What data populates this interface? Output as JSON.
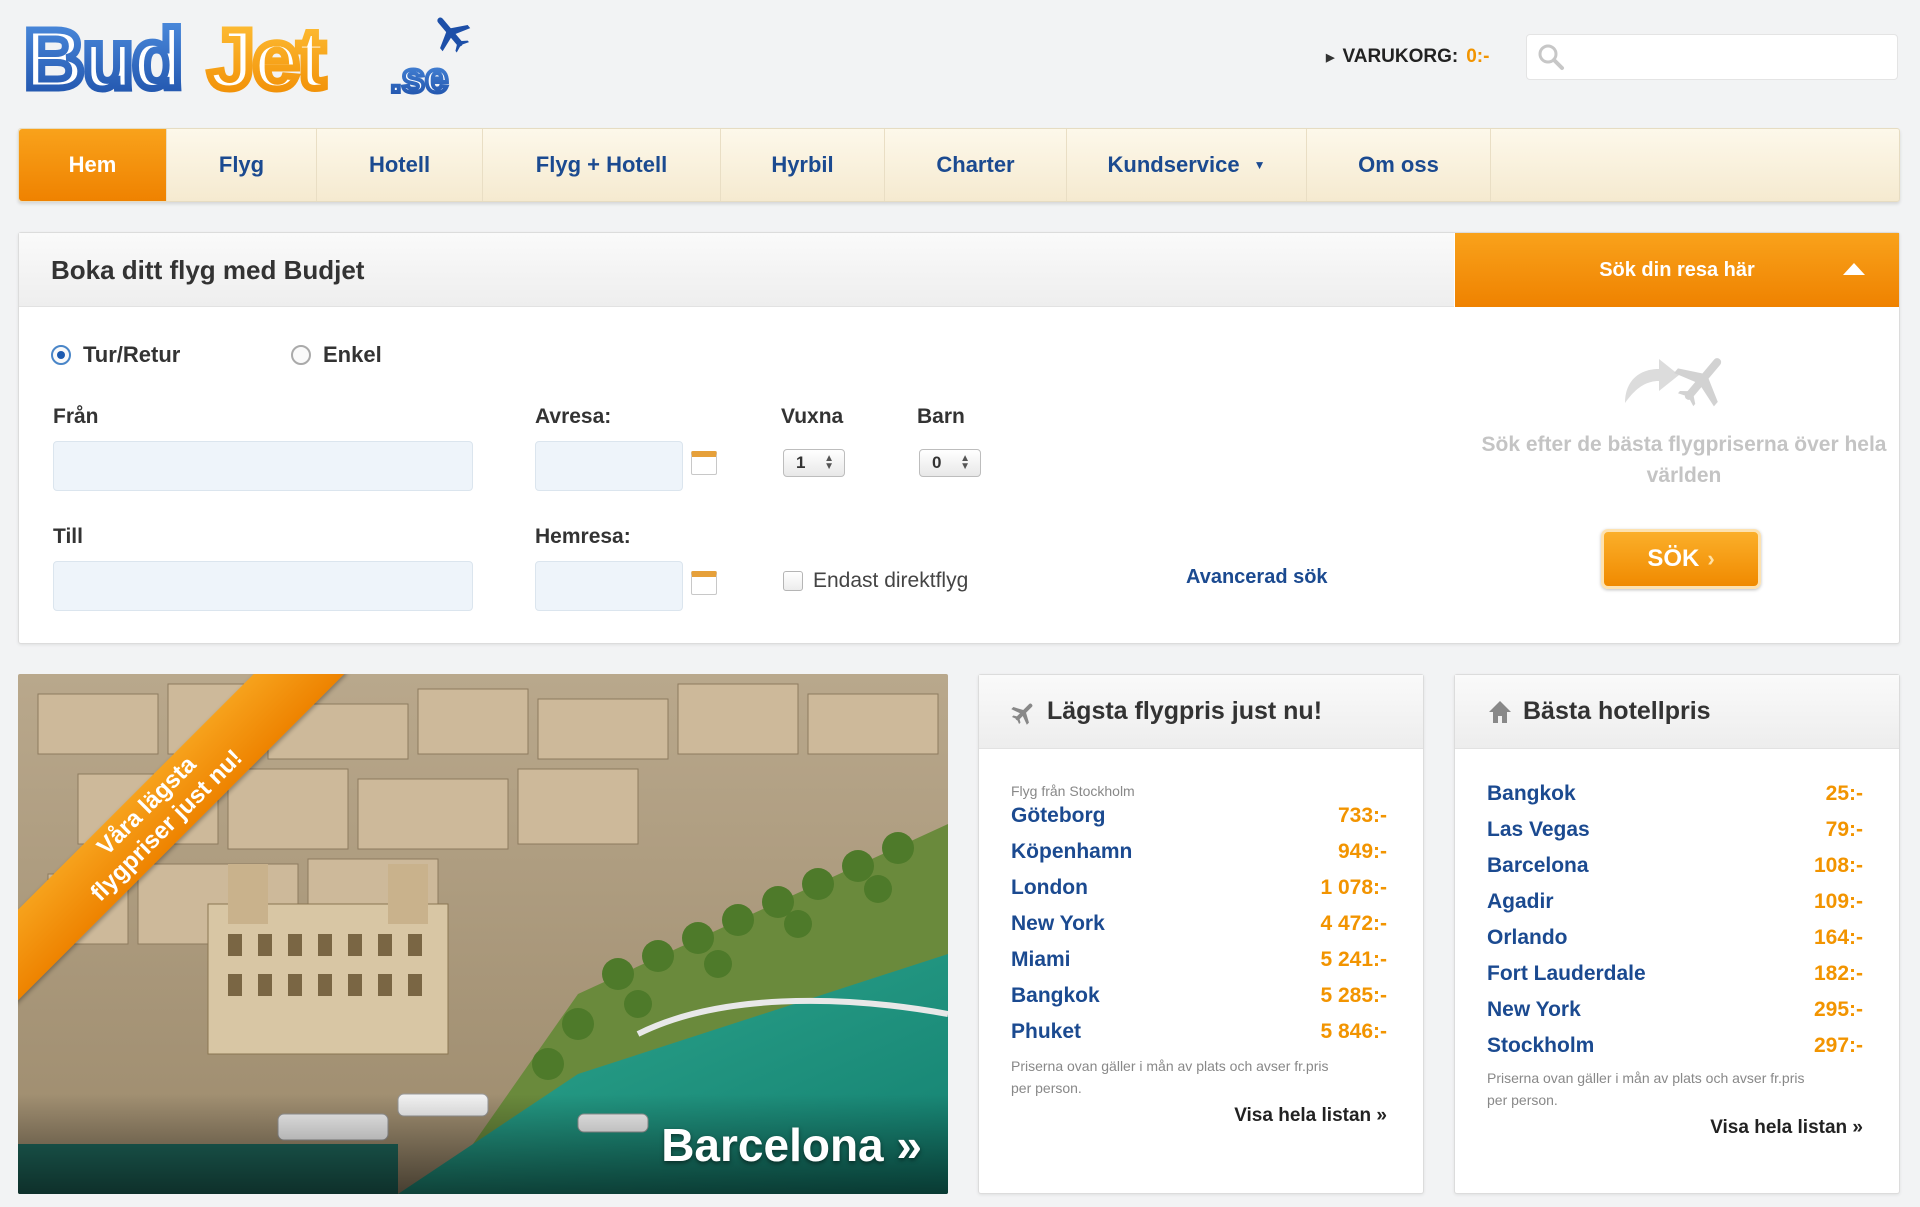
{
  "header": {
    "logo_text": "BudJet.se",
    "cart_label": "VARUKORG:",
    "cart_amount": "0:-",
    "search_placeholder": ""
  },
  "nav": {
    "items": [
      {
        "label": "Hem",
        "active": true
      },
      {
        "label": "Flyg"
      },
      {
        "label": "Hotell"
      },
      {
        "label": "Flyg + Hotell"
      },
      {
        "label": "Hyrbil"
      },
      {
        "label": "Charter"
      },
      {
        "label": "Kundservice",
        "has_dropdown": true
      },
      {
        "label": "Om oss"
      }
    ]
  },
  "booking": {
    "title": "Boka ditt flyg med Budjet",
    "search_tab": "Sök din resa här",
    "trip_types": [
      {
        "label": "Tur/Retur",
        "checked": true
      },
      {
        "label": "Enkel",
        "checked": false
      }
    ],
    "from_label": "Från",
    "to_label": "Till",
    "depart_label": "Avresa:",
    "return_label": "Hemresa:",
    "adults_label": "Vuxna",
    "adults_value": "1",
    "children_label": "Barn",
    "children_value": "0",
    "direct_only_label": "Endast direktflyg",
    "advanced_link": "Avancerad sök",
    "promo_text": "Sök efter de bästa flygpriserna över hela världen",
    "search_button": "SÖK"
  },
  "feature": {
    "ribbon_line1": "Våra lägsta",
    "ribbon_line2": "flygpriser just nu!",
    "caption": "Barcelona »"
  },
  "flights": {
    "title": "Lägsta flygpris just nu!",
    "subtitle": "Flyg från Stockholm",
    "rows": [
      {
        "city": "Göteborg",
        "price": "733:-"
      },
      {
        "city": "Köpenhamn",
        "price": "949:-"
      },
      {
        "city": "London",
        "price": "1 078:-"
      },
      {
        "city": "New York",
        "price": "4 472:-"
      },
      {
        "city": "Miami",
        "price": "5 241:-"
      },
      {
        "city": "Bangkok",
        "price": "5 285:-"
      },
      {
        "city": "Phuket",
        "price": "5 846:-"
      }
    ],
    "note": "Priserna ovan gäller i mån av plats och avser fr.pris per person.",
    "link": "Visa hela listan »"
  },
  "hotels": {
    "title": "Bästa hotellpris",
    "rows": [
      {
        "city": "Bangkok",
        "price": "25:-"
      },
      {
        "city": "Las Vegas",
        "price": "79:-"
      },
      {
        "city": "Barcelona",
        "price": "108:-"
      },
      {
        "city": "Agadir",
        "price": "109:-"
      },
      {
        "city": "Orlando",
        "price": "164:-"
      },
      {
        "city": "Fort Lauderdale",
        "price": "182:-"
      },
      {
        "city": "New York",
        "price": "295:-"
      },
      {
        "city": "Stockholm",
        "price": "297:-"
      }
    ],
    "note": "Priserna ovan gäller i mån av plats och avser fr.pris per person.",
    "link": "Visa hela listan »"
  },
  "colors": {
    "brand_orange": "#f29400",
    "brand_blue": "#1b4a90"
  }
}
